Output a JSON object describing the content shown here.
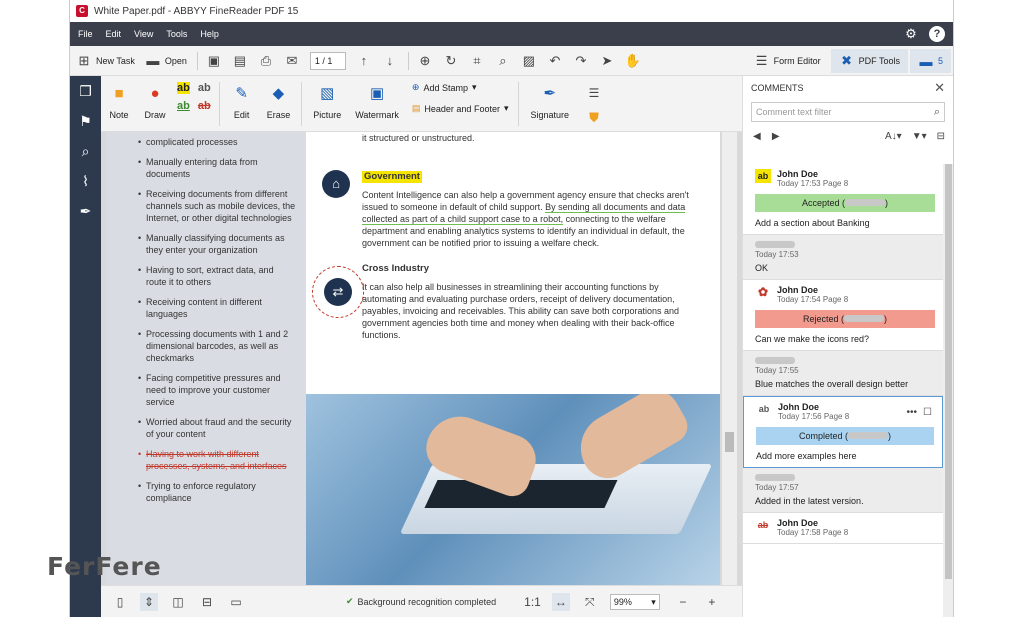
{
  "window": {
    "title": "White Paper.pdf - ABBYY FineReader PDF 15"
  },
  "menu": [
    "File",
    "Edit",
    "View",
    "Tools",
    "Help"
  ],
  "toolbar": {
    "new_task": "New Task",
    "open": "Open",
    "page_value": "1",
    "page_total": "/ 1",
    "form_editor": "Form Editor",
    "pdf_tools": "PDF Tools",
    "comments_count": "5"
  },
  "ribbon": {
    "note": "Note",
    "draw": "Draw",
    "edit": "Edit",
    "erase": "Erase",
    "picture": "Picture",
    "watermark": "Watermark",
    "add_stamp": "Add Stamp",
    "header_footer": "Header and Footer",
    "signature": "Signature",
    "ab1": "ab",
    "ab2": "ab",
    "ab3": "ab",
    "ab4": "ab"
  },
  "document": {
    "left_items": [
      "complicated processes",
      "Manually entering data from documents",
      "Receiving documents from different channels such as mobile devices, the Internet, or other digital technologies",
      "Manually classifying documents as they enter your organization",
      "Having to sort, extract data, and route it to others",
      "Receiving content in different languages",
      "Processing documents with 1 and 2 dimensional barcodes, as well as checkmarks",
      "Facing competitive pressures and need to improve your customer service",
      "Worried about fraud and the security of your content",
      "Having to work with different processes, systems, and interfaces",
      "Trying to enforce regulatory compliance"
    ],
    "top_line": "it structured or unstructured.",
    "government_title": "Government",
    "government_text_a": "Content Intelligence can also help a government agency ensure that checks aren't issued to someone in default of child support.",
    "government_text_b": "By sending all documents and data collected as part of a child support case to a robot,",
    "government_text_c": "connecting to the welfare department and enabling analytics systems to identify an individual in default, the government can be notified prior to issuing a welfare check.",
    "cross_title": "Cross Industry",
    "cross_text": "It can also help all businesses in streamlining their accounting functions by automating and evaluating purchase orders, receipt of delivery documentation, payables, invoicing and receivables. This ability can save both corporations and government agencies both time and money when dealing with their back-office functions."
  },
  "status_bar": {
    "recognition": "Background recognition completed",
    "ratio": "1:1",
    "zoom": "99%"
  },
  "comments": {
    "header": "COMMENTS",
    "filter_placeholder": "Comment text filter",
    "cards": [
      {
        "icon": "ab",
        "author": "John Doe",
        "meta": "Today 17:53  Page 8",
        "status": "Accepted (",
        "status_color": "#a8dd97",
        "text": "Add a section about Banking"
      },
      {
        "reply": true,
        "meta": "Today 17:53",
        "text": "OK"
      },
      {
        "icon": "✿",
        "author": "John Doe",
        "meta": "Today 17:54  Page 8",
        "status": "Rejected (",
        "status_color": "#f29a8e",
        "text": "Can we make the icons red?"
      },
      {
        "reply": true,
        "meta": "Today 17:55",
        "text": "Blue matches the overall design better"
      },
      {
        "icon": "ab",
        "author": "John Doe",
        "meta": "Today 17:56  Page 8",
        "status": "Completed (",
        "status_color": "#a9d3f0",
        "text": "Add more examples here",
        "selected": true
      },
      {
        "reply": true,
        "meta": "Today 17:57",
        "text": "Added in the latest version."
      },
      {
        "icon": "ab",
        "author": "John Doe",
        "meta": "Today 17:58  Page 8"
      }
    ]
  },
  "watermark": "FerFere"
}
